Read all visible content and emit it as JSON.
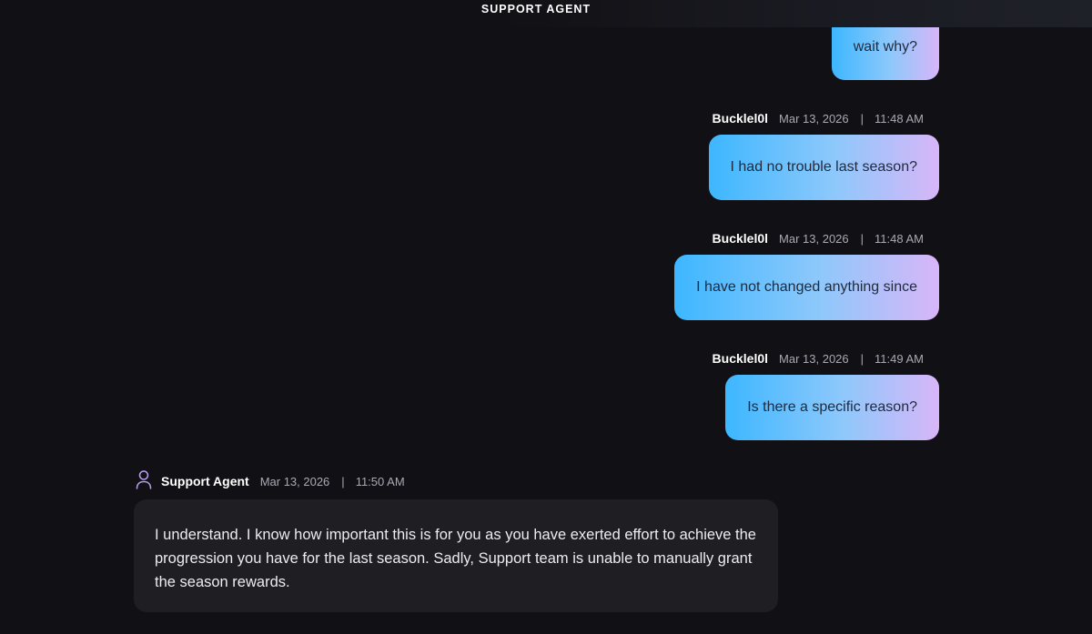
{
  "header": {
    "title": "SUPPORT AGENT"
  },
  "messages": [
    {
      "text": "wait why?"
    },
    {
      "name": "Bucklel0l",
      "date": "Mar 13, 2026",
      "time": "11:48 AM",
      "text": "I had no trouble last season?"
    },
    {
      "name": "Bucklel0l",
      "date": "Mar 13, 2026",
      "time": "11:48 AM",
      "text": "I have not changed anything since"
    },
    {
      "name": "Bucklel0l",
      "date": "Mar 13, 2026",
      "time": "11:49 AM",
      "text": "Is there a specific reason?"
    },
    {
      "name": "Support Agent",
      "date": "Mar 13, 2026",
      "time": "11:50 AM",
      "icon": "user-icon",
      "text": "I understand. I know how important this is for you as you have exerted effort to achieve the progression you have for the last season. Sadly, Support team is unable to manually grant the season rewards."
    }
  ],
  "meta_separator": "|",
  "colors": {
    "background": "#111014",
    "user_bubble_start": "#3db7ff",
    "user_bubble_end": "#d8b6f8",
    "agent_bubble": "#1e1e23",
    "agent_icon": "#b49ce8"
  }
}
